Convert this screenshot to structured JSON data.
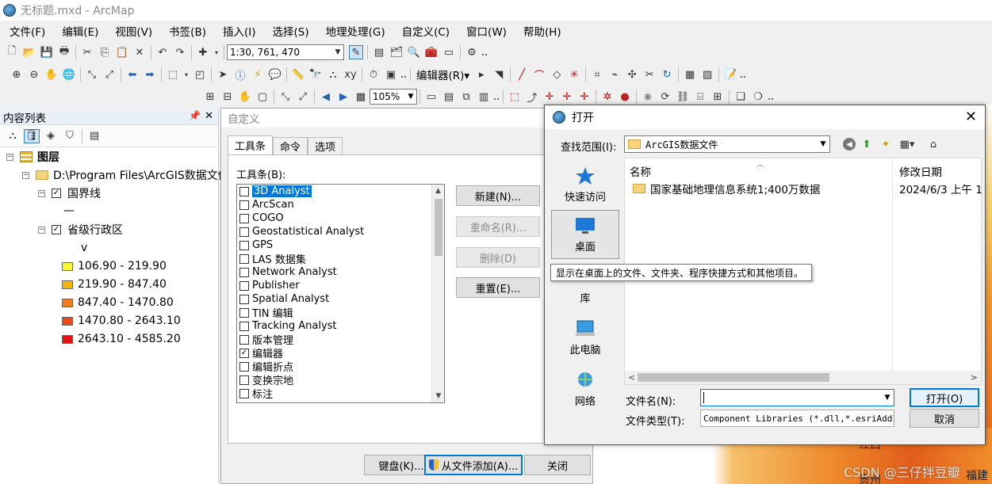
{
  "window": {
    "title": "无标题.mxd - ArcMap"
  },
  "menu": [
    "文件(F)",
    "编辑(E)",
    "视图(V)",
    "书签(B)",
    "插入(I)",
    "选择(S)",
    "地理处理(G)",
    "自定义(C)",
    "窗口(W)",
    "帮助(H)"
  ],
  "toolbar": {
    "scale_value": "1:30, 761, 470",
    "editor_menu": "编辑器(R)▾",
    "zoom_value": "105%"
  },
  "toc": {
    "title": "内容列表",
    "root": "图层",
    "data_frame": "D:\\Program Files\\ArcGIS数据文件",
    "layer1": "国界线",
    "layer1_symbol": "—",
    "layer2": "省级行政区",
    "layer2_field": "v",
    "classes": [
      {
        "label": "106.90 - 219.90",
        "color": "#f5f53a"
      },
      {
        "label": "219.90 - 847.40",
        "color": "#f5b50f"
      },
      {
        "label": "847.40 - 1470.80",
        "color": "#f07c1e"
      },
      {
        "label": "1470.80 - 2643.10",
        "color": "#ec4a1a"
      },
      {
        "label": "2643.10 - 4585.20",
        "color": "#e31212"
      }
    ]
  },
  "customize": {
    "title": "自定义",
    "tabs": [
      "工具条",
      "命令",
      "选项"
    ],
    "list_label": "工具条(B):",
    "toolbars": [
      {
        "label": "3D Analyst",
        "checked": false,
        "selected": true
      },
      {
        "label": "ArcScan",
        "checked": false
      },
      {
        "label": "COGO",
        "checked": false
      },
      {
        "label": "Geostatistical Analyst",
        "checked": false
      },
      {
        "label": "GPS",
        "checked": false
      },
      {
        "label": "LAS 数据集",
        "checked": false
      },
      {
        "label": "Network Analyst",
        "checked": false
      },
      {
        "label": "Publisher",
        "checked": false
      },
      {
        "label": "Spatial Analyst",
        "checked": false
      },
      {
        "label": "TIN 编辑",
        "checked": false
      },
      {
        "label": "Tracking Analyst",
        "checked": false
      },
      {
        "label": "版本管理",
        "checked": false
      },
      {
        "label": "编辑器",
        "checked": true
      },
      {
        "label": "编辑折点",
        "checked": false
      },
      {
        "label": "变换宗地",
        "checked": false
      },
      {
        "label": "标注",
        "checked": false
      }
    ],
    "buttons": {
      "new": "新建(N)...",
      "rename": "重命名(R)...",
      "delete": "删除(D)",
      "reset": "重置(E)...",
      "keyboard": "键盘(K)...",
      "add_from_file": "从文件添加(A)...",
      "close": "关闭"
    }
  },
  "open_dialog": {
    "title": "打开",
    "lookin_label": "查找范围(I):",
    "lookin_value": "ArcGIS数据文件",
    "places": [
      "快速访问",
      "桌面",
      "库",
      "此电脑",
      "网络"
    ],
    "columns": {
      "name": "名称",
      "modified": "修改日期"
    },
    "files": [
      {
        "name": "国家基础地理信息系统1;400万数据",
        "modified": "2024/6/3 上午 1"
      }
    ],
    "filename_label": "文件名(N):",
    "filename_value": "",
    "filetype_label": "文件类型(T):",
    "filetype_value": "Component Libraries (*.dll,*.esriAddI",
    "open_button": "打开(O)",
    "cancel_button": "取消",
    "tooltip": "显示在桌面上的文件、文件夹、程序快捷方式和其他项目。"
  },
  "map": {
    "labels": [
      "江西",
      "贵州",
      "福建"
    ],
    "watermark": "CSDN @三仔拌豆瓣"
  }
}
